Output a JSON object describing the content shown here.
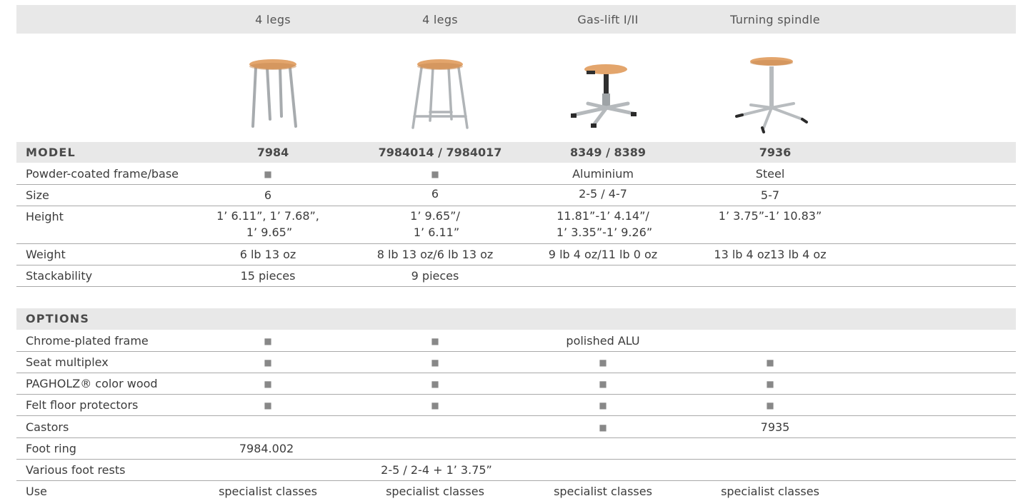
{
  "columns": [
    "4 legs",
    "4 legs",
    "Gas-lift I/II",
    "Turning spindle"
  ],
  "product_images": [
    "four-leg-stool",
    "four-leg-stool-with-footrest",
    "gas-lift-stool",
    "turning-spindle-stool"
  ],
  "model_section": {
    "title": "MODEL",
    "models": [
      "7984",
      "7984014 / 7984017",
      "8349 / 8389",
      "7936"
    ],
    "rows": [
      {
        "label": "Powder-coated frame/base",
        "cells": [
          "■",
          "■",
          "Aluminium",
          "Steel"
        ]
      },
      {
        "label": "Size",
        "cells": [
          "6",
          "6",
          "2-5 / 4-7",
          "5-7"
        ]
      },
      {
        "label": "Height",
        "cells": [
          "1’ 6.11”, 1’ 7.68”,",
          "1’ 9.65”/",
          "11.81”-1’ 4.14”/",
          "1’ 3.75”-1’ 10.83”"
        ],
        "cells2": [
          "1’ 9.65”",
          "1’ 6.11”",
          "1’ 3.35”-1’ 9.26”",
          ""
        ]
      },
      {
        "label": "Weight",
        "cells": [
          "6 lb 13 oz",
          "8 lb 13 oz/6 lb 13 oz",
          "9 lb 4 oz/11 lb 0 oz",
          "13 lb 4 oz13 lb 4 oz"
        ]
      },
      {
        "label": "Stackability",
        "cells": [
          "15 pieces",
          "9 pieces",
          "",
          ""
        ]
      }
    ]
  },
  "options_section": {
    "title": "OPTIONS",
    "rows": [
      {
        "label": "Chrome-plated frame",
        "cells": [
          "■",
          "■",
          "polished ALU",
          ""
        ]
      },
      {
        "label": "Seat multiplex",
        "cells": [
          "■",
          "■",
          "■",
          "■"
        ]
      },
      {
        "label": "PAGHOLZ® color wood",
        "cells": [
          "■",
          "■",
          "■",
          "■"
        ]
      },
      {
        "label": "Felt floor protectors",
        "cells": [
          "■",
          "■",
          "■",
          "■"
        ]
      },
      {
        "label": "Castors",
        "cells": [
          "",
          "",
          "■",
          "7935"
        ]
      },
      {
        "label": "Foot ring",
        "cells": [
          "7984.002",
          "",
          "",
          ""
        ]
      },
      {
        "label": "Various foot rests",
        "cells": [
          "",
          "2-5 / 2-4 + 1’ 3.75”",
          "",
          ""
        ]
      },
      {
        "label": "Use",
        "cells": [
          "specialist classes",
          "specialist classes",
          "specialist classes",
          "specialist classes"
        ]
      }
    ]
  },
  "colors": {
    "band": "#e8e8e8",
    "rule": "#a9a9a9",
    "seat_wood": "#e3a56c",
    "frame": "#b8bcbf"
  }
}
